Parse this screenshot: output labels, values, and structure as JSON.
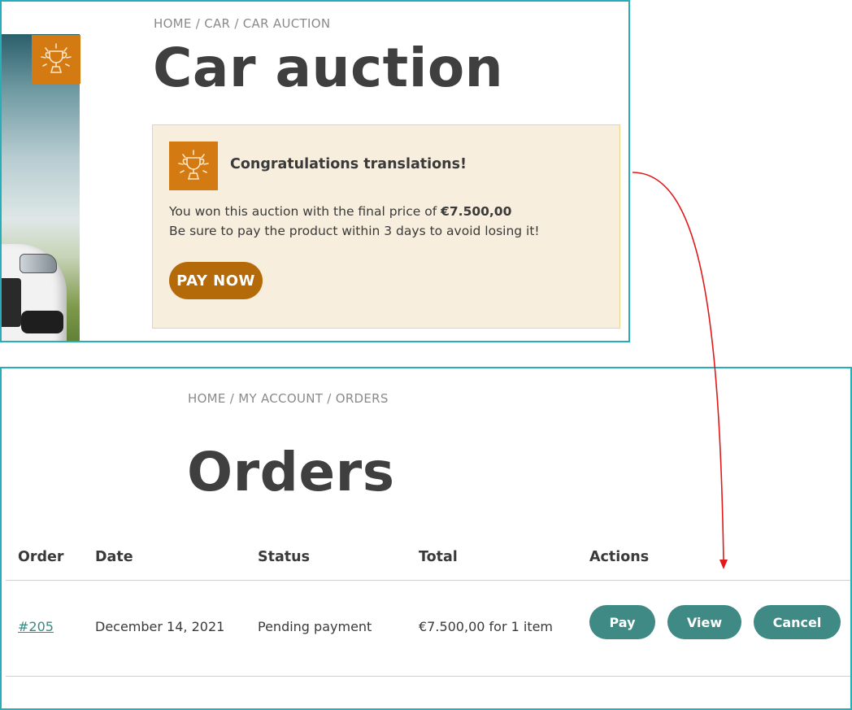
{
  "auction_page": {
    "breadcrumb": [
      "HOME",
      "CAR",
      "CAR AUCTION"
    ],
    "breadcrumb_separator": " / ",
    "title": "Car auction",
    "notice": {
      "heading": "Congratulations translations!",
      "won_text": "You won this auction with the final price of",
      "final_price": "€7.500,00",
      "pay_reminder": "Be sure to pay the product within 3 days to avoid losing it!",
      "pay_button": "PAY NOW"
    }
  },
  "orders_page": {
    "breadcrumb": [
      "HOME",
      "MY ACCOUNT",
      "ORDERS"
    ],
    "breadcrumb_separator": " / ",
    "title": "Orders",
    "columns": [
      "Order",
      "Date",
      "Status",
      "Total",
      "Actions"
    ],
    "rows": [
      {
        "order": "#205",
        "date": "December 14, 2021",
        "status": "Pending payment",
        "total": "€7.500,00 for 1 item",
        "actions": [
          "Pay",
          "View",
          "Cancel"
        ]
      }
    ]
  },
  "colors": {
    "panel_border": "#27aeb9",
    "trophy_orange": "#d47a12",
    "pay_now_button": "#b56a0a",
    "notice_background": "#f8eedd",
    "action_button": "#3f8a84",
    "arrow": "#e0191b"
  },
  "icons": [
    "trophy-icon",
    "car-image"
  ]
}
